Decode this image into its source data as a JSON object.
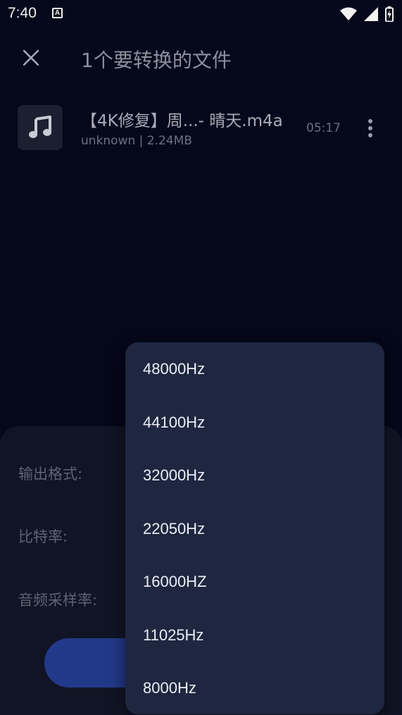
{
  "status_bar": {
    "time": "7:40",
    "notification_glyph": "A"
  },
  "app_bar": {
    "title": "1个要转换的文件"
  },
  "file": {
    "name": "【4K修复】周...- 晴天.m4a",
    "meta": "unknown | 2.24MB",
    "duration": "05:17"
  },
  "sheet": {
    "output_format_label": "输出格式:",
    "bitrate_label": "比特率:",
    "sample_rate_label": "音频采样率:"
  },
  "dropdown": {
    "items": [
      "48000Hz",
      "44100Hz",
      "32000Hz",
      "22050Hz",
      "16000HZ",
      "11025Hz",
      "8000Hz"
    ]
  },
  "colors": {
    "accent": "#22398a",
    "popup_bg": "#1f2640",
    "background": "#05071a"
  }
}
